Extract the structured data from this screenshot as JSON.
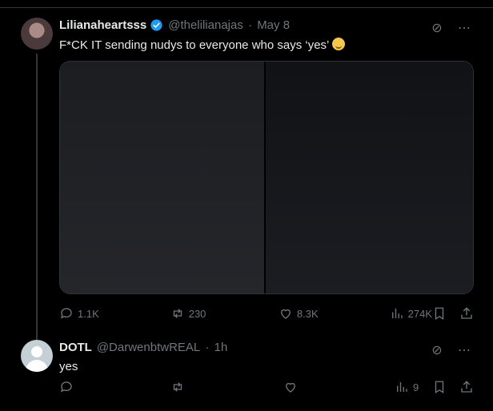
{
  "tweet": {
    "display_name": "Lilianaheartsss",
    "handle": "@thelilianajas",
    "time": "May 8",
    "text": "F*CK IT sending nudys to everyone who says ‘yes’",
    "stats": {
      "replies": "1.1K",
      "reposts": "230",
      "likes": "8.3K",
      "views": "274K"
    }
  },
  "reply": {
    "display_name": "DOTL",
    "handle": "@DarwenbtwREAL",
    "time": "1h",
    "text": "yes",
    "stats": {
      "replies": "",
      "reposts": "",
      "likes": "",
      "views": "9"
    }
  },
  "colors": {
    "background": "#000000",
    "text": "#e7e9ea",
    "muted": "#71767b",
    "verified": "#1d9bf0",
    "divider": "#2f3336"
  }
}
